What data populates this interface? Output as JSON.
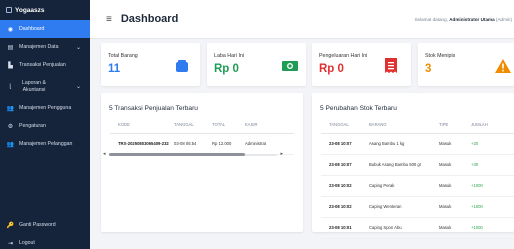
{
  "brand": {
    "name": "Yogaaszs"
  },
  "sidebar": {
    "items": [
      {
        "label": "Dashboard"
      },
      {
        "label": "Manajemen Data"
      },
      {
        "label": "Transaksi Penjualan"
      },
      {
        "label": "Laporan & Akuntansi"
      },
      {
        "label": "Manajemen Pengguna"
      },
      {
        "label": "Pengaturan"
      },
      {
        "label": "Manajemen Pelanggan"
      }
    ],
    "bottom": [
      {
        "label": "Ganti Password"
      },
      {
        "label": "Logout"
      }
    ]
  },
  "header": {
    "title": "Dashboard",
    "welcome_prefix": "Selamat datang, ",
    "welcome_user": "Administrator Utama",
    "welcome_role": " (Admin)"
  },
  "stats": [
    {
      "label": "Total Barang",
      "value": "11",
      "color": "#2f7bf0",
      "icon": "box-icon"
    },
    {
      "label": "Laba Hari Ini",
      "value": "Rp 0",
      "color": "#1f9d55",
      "icon": "money-icon"
    },
    {
      "label": "Pengeluaran Hari Ini",
      "value": "Rp 0",
      "color": "#e03131",
      "icon": "receipt-icon"
    },
    {
      "label": "Stok Menipis",
      "value": "3",
      "color": "#f08c00",
      "icon": "warning-icon"
    }
  ],
  "sales": {
    "title": "5 Transaksi Penjualan Terbaru",
    "columns": [
      "KODE",
      "TANGGAL",
      "TOTAL",
      "KASIR"
    ],
    "rows": [
      [
        "TRX-20250803065409-232",
        "03-08 06:54",
        "Rp 12.000",
        "Administrat"
      ]
    ]
  },
  "stock": {
    "title": "5 Perubahan Stok Terbaru",
    "columns": [
      "TANGGAL",
      "BARANG",
      "TIPE",
      "JUMLAH"
    ],
    "rows": [
      [
        "23-08 10:07",
        "Asang Bambu 1 kg",
        "Masuk",
        "+20"
      ],
      [
        "23-08 10:07",
        "Bubuk Asang Bambu 500 gr",
        "Masuk",
        "+30"
      ],
      [
        "23-08 10:02",
        "Caping Perak",
        "Masuk",
        "+1000"
      ],
      [
        "23-08 10:02",
        "Caping Wenteran",
        "Masuk",
        "+1000"
      ],
      [
        "23-08 10:01",
        "Caping Spon Abu",
        "Masuk",
        "+1000"
      ]
    ]
  }
}
